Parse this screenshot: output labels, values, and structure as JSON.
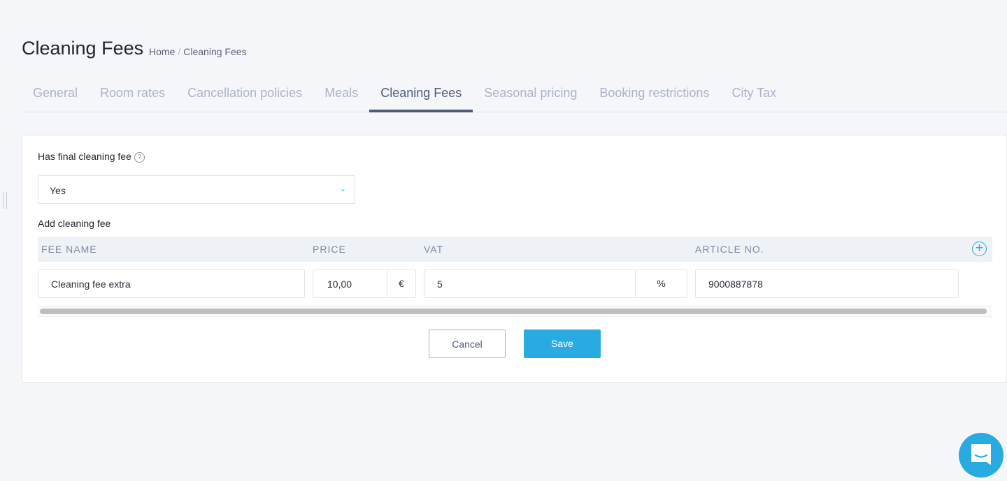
{
  "header": {
    "title": "Cleaning Fees",
    "breadcrumb": [
      "Home",
      "Cleaning Fees"
    ]
  },
  "tabs": [
    {
      "label": "General"
    },
    {
      "label": "Room rates"
    },
    {
      "label": "Cancellation policies"
    },
    {
      "label": "Meals"
    },
    {
      "label": "Cleaning Fees",
      "active": true
    },
    {
      "label": "Seasonal pricing"
    },
    {
      "label": "Booking restrictions"
    },
    {
      "label": "City Tax"
    }
  ],
  "form": {
    "has_fee_label": "Has final cleaning fee",
    "help_icon": "?",
    "has_fee_value": "Yes",
    "add_label": "Add cleaning fee",
    "columns": [
      "FEE NAME",
      "PRICE",
      "VAT",
      "ARTICLE NO."
    ],
    "row": {
      "fee_name": "Cleaning fee extra",
      "price": "10,00",
      "currency": "€",
      "vat": "5",
      "vat_unit": "%",
      "article_no": "9000887878"
    },
    "cancel": "Cancel",
    "save": "Save"
  },
  "colors": {
    "accent": "#29abe2",
    "active_tab": "#4d5b78"
  }
}
